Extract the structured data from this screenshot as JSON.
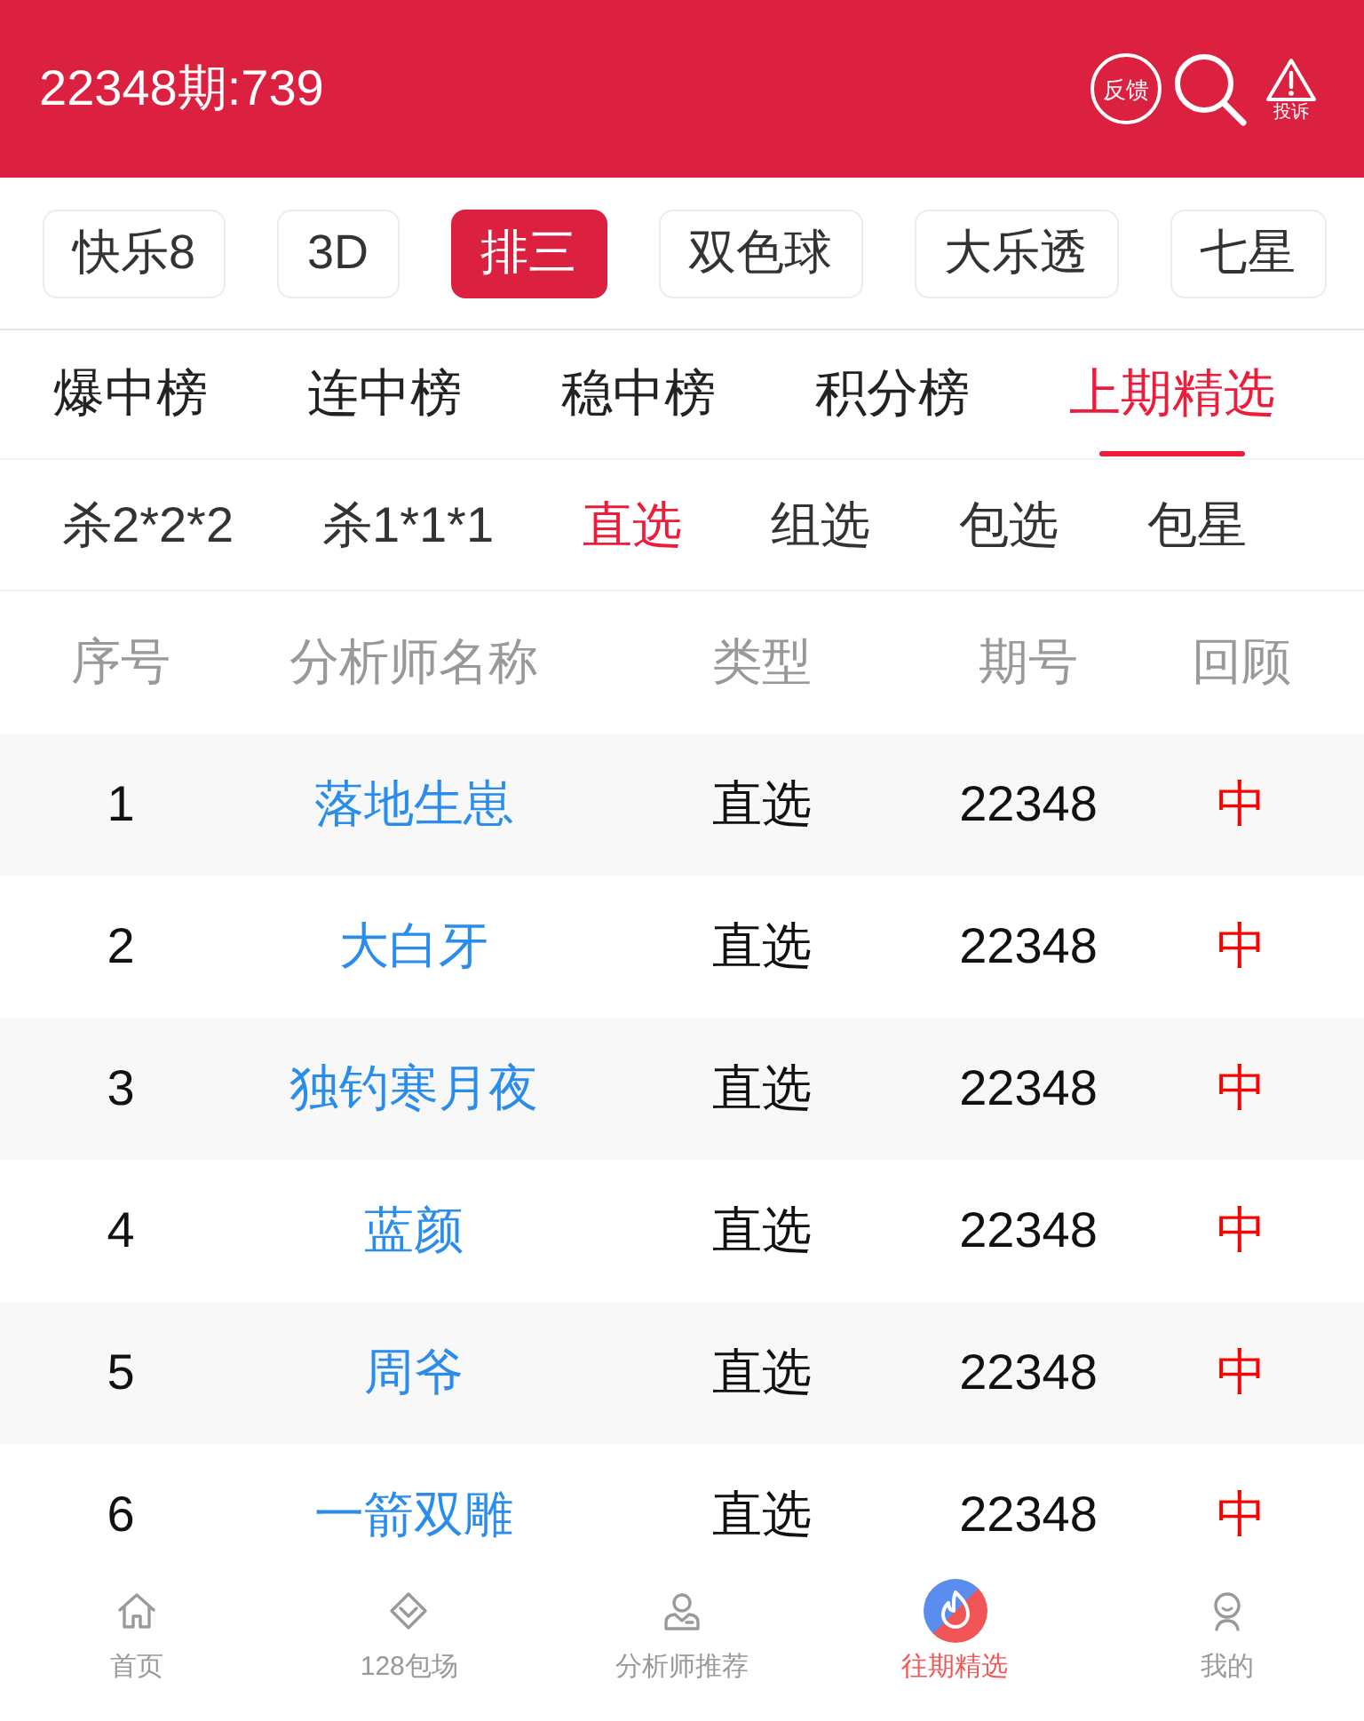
{
  "header": {
    "title": "22348期:739",
    "feedback_label": "反馈",
    "complaint_label": "投诉"
  },
  "lottery_tabs": [
    {
      "label": "快乐8",
      "selected": false
    },
    {
      "label": "3D",
      "selected": false
    },
    {
      "label": "排三",
      "selected": true
    },
    {
      "label": "双色球",
      "selected": false
    },
    {
      "label": "大乐透",
      "selected": false
    },
    {
      "label": "七星",
      "selected": false
    }
  ],
  "rank_tabs": [
    {
      "label": "爆中榜",
      "selected": false
    },
    {
      "label": "连中榜",
      "selected": false
    },
    {
      "label": "稳中榜",
      "selected": false
    },
    {
      "label": "积分榜",
      "selected": false
    },
    {
      "label": "上期精选",
      "selected": true
    }
  ],
  "play_tabs": [
    {
      "label": "杀2*2*2",
      "selected": false
    },
    {
      "label": "杀1*1*1",
      "selected": false
    },
    {
      "label": "直选",
      "selected": true
    },
    {
      "label": "组选",
      "selected": false
    },
    {
      "label": "包选",
      "selected": false
    },
    {
      "label": "包星",
      "selected": false
    }
  ],
  "table": {
    "columns": [
      "序号",
      "分析师名称",
      "类型",
      "期号",
      "回顾"
    ],
    "rows": [
      {
        "index": "1",
        "analyst": "落地生崽",
        "type": "直选",
        "period": "22348",
        "review": "中"
      },
      {
        "index": "2",
        "analyst": "大白牙",
        "type": "直选",
        "period": "22348",
        "review": "中"
      },
      {
        "index": "3",
        "analyst": "独钓寒月夜",
        "type": "直选",
        "period": "22348",
        "review": "中"
      },
      {
        "index": "4",
        "analyst": "蓝颜",
        "type": "直选",
        "period": "22348",
        "review": "中"
      },
      {
        "index": "5",
        "analyst": "周爷",
        "type": "直选",
        "period": "22348",
        "review": "中"
      },
      {
        "index": "6",
        "analyst": "一箭双雕",
        "type": "直选",
        "period": "22348",
        "review": "中"
      }
    ]
  },
  "bottom_nav": [
    {
      "label": "首页",
      "selected": false
    },
    {
      "label": "128包场",
      "selected": false
    },
    {
      "label": "分析师推荐",
      "selected": false
    },
    {
      "label": "往期精选",
      "selected": true
    },
    {
      "label": "我的",
      "selected": false
    }
  ]
}
